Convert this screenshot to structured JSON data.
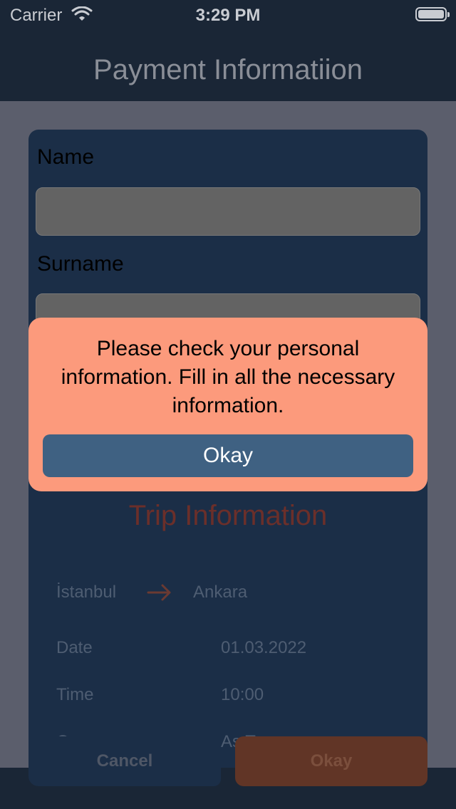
{
  "status_bar": {
    "carrier": "Carrier",
    "time": "3:29 PM",
    "wifi_icon": "wifi-icon",
    "battery_icon": "battery-icon"
  },
  "nav": {
    "title": "Payment Informatiion"
  },
  "form": {
    "name_label": "Name",
    "name_value": "",
    "surname_label": "Surname",
    "surname_value": ""
  },
  "trip": {
    "title": "Trip Information",
    "from": "İstanbul",
    "to": "Ankara",
    "arrow_icon": "arrow-right-icon",
    "rows": [
      {
        "label": "Date",
        "value": "01.03.2022"
      },
      {
        "label": "Time",
        "value": "10:00"
      },
      {
        "label": "C",
        "value": "As T"
      }
    ]
  },
  "buttons": {
    "cancel": "Cancel",
    "okay": "Okay"
  },
  "alert": {
    "message": "Please check your personal information. Fill in all the necessary information.",
    "button": "Okay"
  },
  "colors": {
    "nav_bg": "#1a2636",
    "backdrop": "#5b5e6c",
    "card_bg": "#1b2e47",
    "alert_bg": "#fc9a7c",
    "alert_button": "#3f6182",
    "accent": "#613526"
  }
}
